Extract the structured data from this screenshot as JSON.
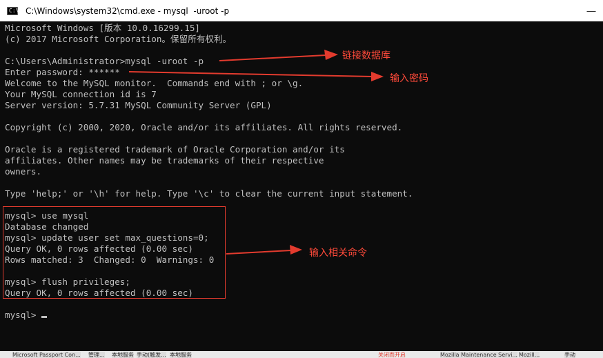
{
  "window": {
    "title": "C:\\Windows\\system32\\cmd.exe - mysql  -uroot -p",
    "icon": "C:\\",
    "minimize_label": "—"
  },
  "console_lines": [
    "Microsoft Windows [版本 10.0.16299.15]",
    "(c) 2017 Microsoft Corporation。保留所有权利。",
    "",
    "C:\\Users\\Administrator>mysql -uroot -p",
    "Enter password: ******",
    "Welcome to the MySQL monitor.  Commands end with ; or \\g.",
    "Your MySQL connection id is 7",
    "Server version: 5.7.31 MySQL Community Server (GPL)",
    "",
    "Copyright (c) 2000, 2020, Oracle and/or its affiliates. All rights reserved.",
    "",
    "Oracle is a registered trademark of Oracle Corporation and/or its",
    "affiliates. Other names may be trademarks of their respective",
    "owners.",
    "",
    "Type 'help;' or '\\h' for help. Type '\\c' to clear the current input statement.",
    "",
    "mysql> use mysql",
    "Database changed",
    "mysql> update user set max_questions=0;",
    "Query OK, 0 rows affected (0.00 sec)",
    "Rows matched: 3  Changed: 0  Warnings: 0",
    "",
    "mysql> flush privileges;",
    "Query OK, 0 rows affected (0.00 sec)",
    "",
    "mysql> "
  ],
  "annotations": {
    "connect_db": "链接数据库",
    "enter_password": "输入密码",
    "enter_commands": "输入相关命令"
  },
  "taskbar": {
    "items": [
      "Microsoft Passport Con...",
      "管理...",
      "本地服务",
      "手动(触发...",
      "本地服务"
    ],
    "right_items": [
      "关闭而开启",
      "Mozilla Maintenance Servi...",
      "Mozill...",
      "手动"
    ]
  },
  "colors": {
    "console_bg": "#0c0c0c",
    "console_text": "#c0c0c0",
    "annotation_red": "#ff4a3a",
    "title_bar_bg": "#ffffff"
  }
}
